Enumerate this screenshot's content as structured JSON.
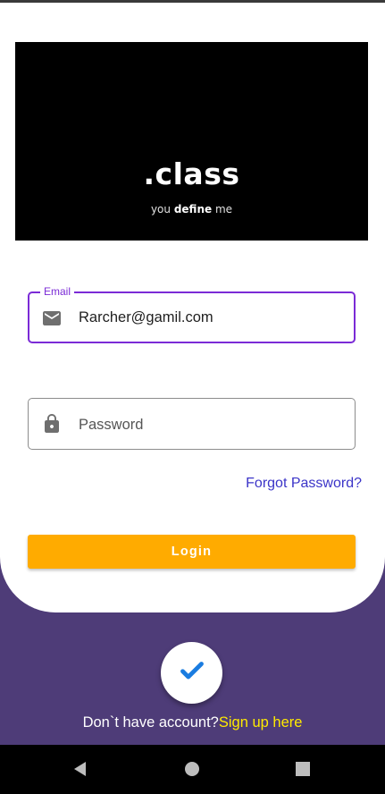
{
  "brand": {
    "logo_text": ".class",
    "tagline_prefix": "you ",
    "tagline_bold": "define",
    "tagline_suffix": " me"
  },
  "form": {
    "email": {
      "label": "Email",
      "value": "Rarcher@gamil.com",
      "icon": "mail-icon"
    },
    "password": {
      "placeholder": "Password",
      "icon": "lock-icon"
    },
    "forgot_password": "Forgot Password?",
    "login_label": "Login"
  },
  "footer": {
    "prompt": "Don`t have account?",
    "signup_link": "Sign up here",
    "fab_icon": "check-icon"
  },
  "navbar": {
    "back_icon": "nav-back-icon",
    "home_icon": "nav-home-icon",
    "recent_icon": "nav-recents-icon"
  },
  "colors": {
    "accent": "#7b2bd6",
    "login_button": "#ffab00",
    "background": "#4e3c78",
    "link": "#3b34c8",
    "signup_link": "#ffea00",
    "check": "#1a7ce0"
  }
}
